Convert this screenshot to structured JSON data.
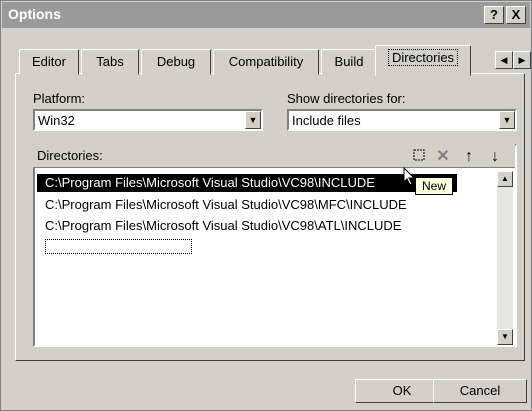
{
  "window": {
    "title": "Options",
    "help_label": "?",
    "close_label": "X"
  },
  "tabs": [
    {
      "label": "Editor"
    },
    {
      "label": "Tabs"
    },
    {
      "label": "Debug"
    },
    {
      "label": "Compatibility"
    },
    {
      "label": "Build"
    },
    {
      "label": "Directories"
    }
  ],
  "active_tab": "Directories",
  "platform": {
    "label": "Platform:",
    "value": "Win32"
  },
  "show_dirs": {
    "label": "Show directories for:",
    "value": "Include files"
  },
  "directories": {
    "label": "Directories:",
    "items": [
      "C:\\Program Files\\Microsoft Visual Studio\\VC98\\INCLUDE",
      "C:\\Program Files\\Microsoft Visual Studio\\VC98\\MFC\\INCLUDE",
      "C:\\Program Files\\Microsoft Visual Studio\\VC98\\ATL\\INCLUDE"
    ],
    "selected_index": 0
  },
  "toolbar": {
    "new_tooltip": "New"
  },
  "footer": {
    "ok_label": "OK",
    "cancel_label": "Cancel"
  }
}
